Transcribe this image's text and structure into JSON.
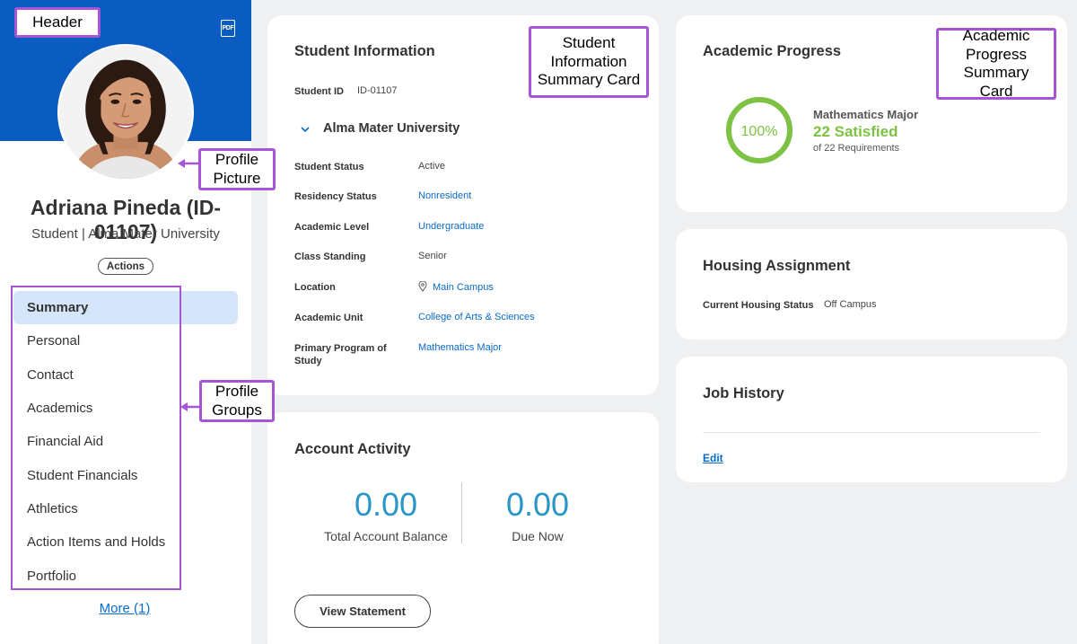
{
  "profile": {
    "name": "Adriana Pineda (ID-01107)",
    "subtitle": "Student | Alma Mater University",
    "actions_label": "Actions",
    "pdf_label": "PDF",
    "nav_items": [
      "Summary",
      "Personal",
      "Contact",
      "Academics",
      "Financial Aid",
      "Student Financials",
      "Athletics",
      "Action Items and Holds",
      "Portfolio"
    ],
    "active_nav": "Summary",
    "more_label": "More (1)"
  },
  "student_info": {
    "title": "Student Information",
    "student_id_label": "Student ID",
    "student_id_value": "ID-01107",
    "university": "Alma Mater University",
    "fields": [
      {
        "label": "Student Status",
        "value": "Active",
        "link": false
      },
      {
        "label": "Residency Status",
        "value": "Nonresident",
        "link": true
      },
      {
        "label": "Academic Level",
        "value": "Undergraduate",
        "link": true
      },
      {
        "label": "Class Standing",
        "value": "Senior",
        "link": false
      },
      {
        "label": "Location",
        "value": "Main Campus",
        "link": true,
        "icon": "location-pin-icon"
      },
      {
        "label": "Academic Unit",
        "value": "College of Arts & Sciences",
        "link": true
      },
      {
        "label": "Primary Program of Study",
        "value": "Mathematics Major",
        "link": true
      }
    ]
  },
  "account_activity": {
    "title": "Account Activity",
    "total_balance_value": "0.00",
    "total_balance_label": "Total Account Balance",
    "due_now_value": "0.00",
    "due_now_label": "Due Now",
    "view_statement_label": "View Statement"
  },
  "academic_progress": {
    "title": "Academic Progress",
    "percent_text": "100%",
    "percent_value": 100,
    "program": "Mathematics Major",
    "satisfied": "22 Satisfied",
    "requirements": "of 22 Requirements"
  },
  "housing": {
    "title": "Housing Assignment",
    "status_label": "Current Housing Status",
    "status_value": "Off Campus"
  },
  "job_history": {
    "title": "Job History",
    "edit_label": "Edit"
  },
  "callouts": {
    "header": "Header",
    "profile_picture": "Profile Picture",
    "profile_groups": "Profile Groups",
    "student_info_card": "Student Information Summary Card",
    "academic_progress_card": "Academic Progress Summary Card"
  },
  "colors": {
    "header_blue": "#0b5cc0",
    "link_blue": "#0b6bcb",
    "progress_green": "#7dc243",
    "balance_blue": "#2a96c8",
    "callout_purple": "#a655d6",
    "nav_active": "#d5e6fb"
  }
}
